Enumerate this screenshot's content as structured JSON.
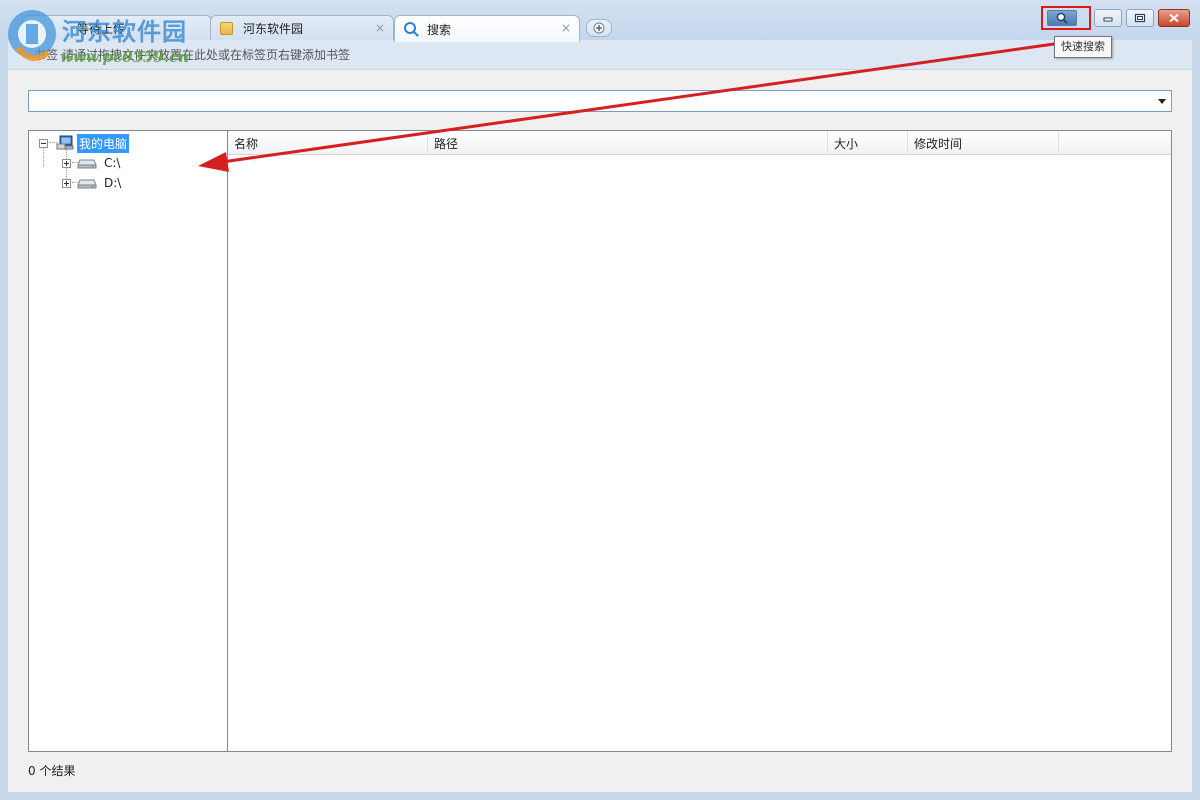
{
  "tabs": [
    {
      "label": "等待上传",
      "icon": "upload-icon",
      "active": false
    },
    {
      "label": "河东软件园",
      "icon": "folder-icon",
      "active": false,
      "close": "×"
    },
    {
      "label": "搜索",
      "icon": "search-icon",
      "active": true,
      "close": "×"
    }
  ],
  "new_tab_icon": "plus-icon",
  "window_controls": {
    "quick_search_icon": "magnifier-icon",
    "minimize_icon": "minimize-icon",
    "maximize_icon": "maximize-icon",
    "close_icon": "close-icon",
    "tooltip": "快速搜索"
  },
  "bookmark_bar": {
    "label": "书签",
    "hint": "请通过拖拽文件夹放置在此处或在标签页右键添加书签"
  },
  "search": {
    "value": "",
    "placeholder": ""
  },
  "tree": {
    "root": {
      "label": "我的电脑",
      "icon": "computer-icon",
      "expanded": true,
      "selected": true
    },
    "children": [
      {
        "label": "C:\\",
        "icon": "drive-icon",
        "expanded": false
      },
      {
        "label": "D:\\",
        "icon": "drive-icon",
        "expanded": false
      }
    ]
  },
  "results_table": {
    "columns": [
      "名称",
      "路径",
      "大小",
      "修改时间"
    ],
    "rows": []
  },
  "status": {
    "result_count": "0 个结果"
  },
  "watermark": {
    "site_name": "河东软件园",
    "url": "www.pc0359.cn"
  },
  "colors": {
    "annotation": "#e0171c",
    "selection": "#3399ff",
    "frame": "#c9d9ec"
  }
}
